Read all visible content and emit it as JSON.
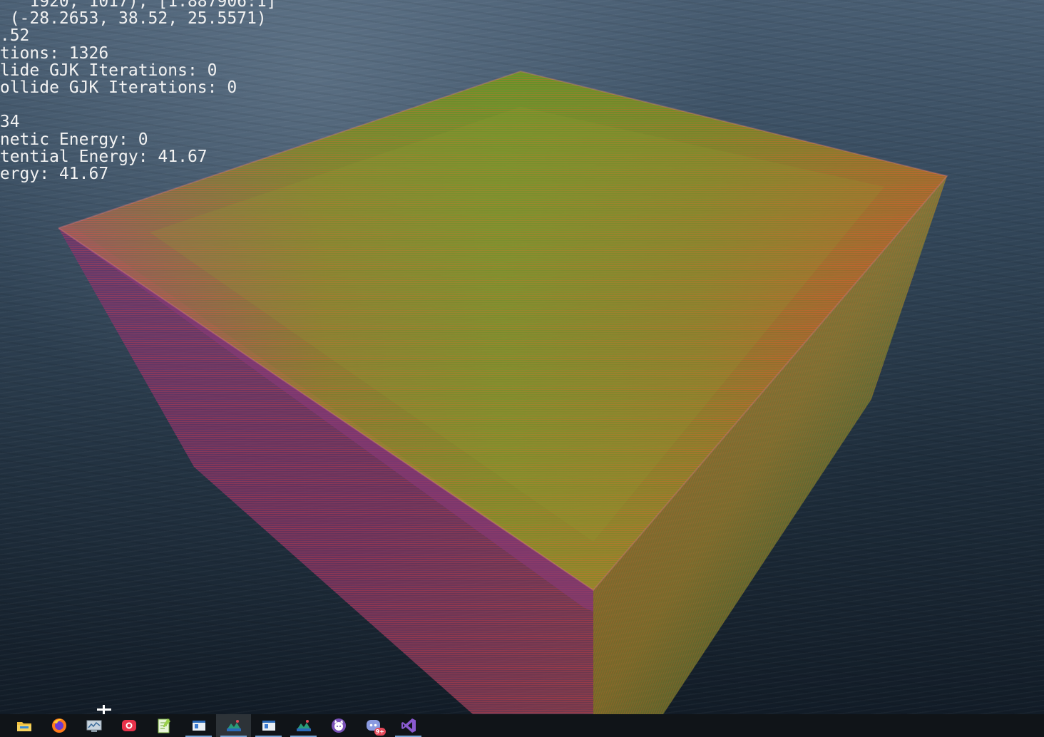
{
  "debug": {
    "lines": [
      "    1920, 1017), [1.887906:1]",
      "  (-28.2653, 38.52, 25.5571)",
      " .52",
      " tions: 1326",
      " lide GJK Iterations: 0",
      " ollide GJK Iterations: 0",
      "",
      " 34",
      " netic Energy: 0",
      " tential Energy: 41.67",
      " ergy: 41.67"
    ]
  },
  "taskbar": {
    "items": [
      {
        "name": "file-explorer",
        "icon": "folder-icon",
        "running": false,
        "active": false
      },
      {
        "name": "firefox",
        "icon": "firefox-icon",
        "running": false,
        "active": false
      },
      {
        "name": "performance-monitor",
        "icon": "monitor-chart-icon",
        "running": false,
        "active": false
      },
      {
        "name": "screen-recorder",
        "icon": "camera-icon",
        "running": false,
        "active": false
      },
      {
        "name": "notepad-plus",
        "icon": "notepad-icon",
        "running": false,
        "active": false
      },
      {
        "name": "app-window-1",
        "icon": "window-icon",
        "running": true,
        "active": false
      },
      {
        "name": "ocean-app-1",
        "icon": "landscape-icon",
        "running": true,
        "active": true
      },
      {
        "name": "app-window-2",
        "icon": "window-icon",
        "running": true,
        "active": false
      },
      {
        "name": "ocean-app-2",
        "icon": "landscape-icon",
        "running": true,
        "active": false
      },
      {
        "name": "github-desktop",
        "icon": "octocat-icon",
        "running": false,
        "active": false
      },
      {
        "name": "discord",
        "icon": "discord-icon",
        "running": false,
        "active": false,
        "badge": "9+"
      },
      {
        "name": "visual-studio",
        "icon": "visual-studio-icon",
        "running": true,
        "active": false
      }
    ]
  },
  "colors": {
    "top_face_center": "#8aa22c",
    "top_face_left": "#c0566e",
    "top_face_right": "#e06a2c",
    "left_face": "#8c3a7a",
    "right_face": "#b07a28",
    "taskbar_bg": "#101418"
  }
}
